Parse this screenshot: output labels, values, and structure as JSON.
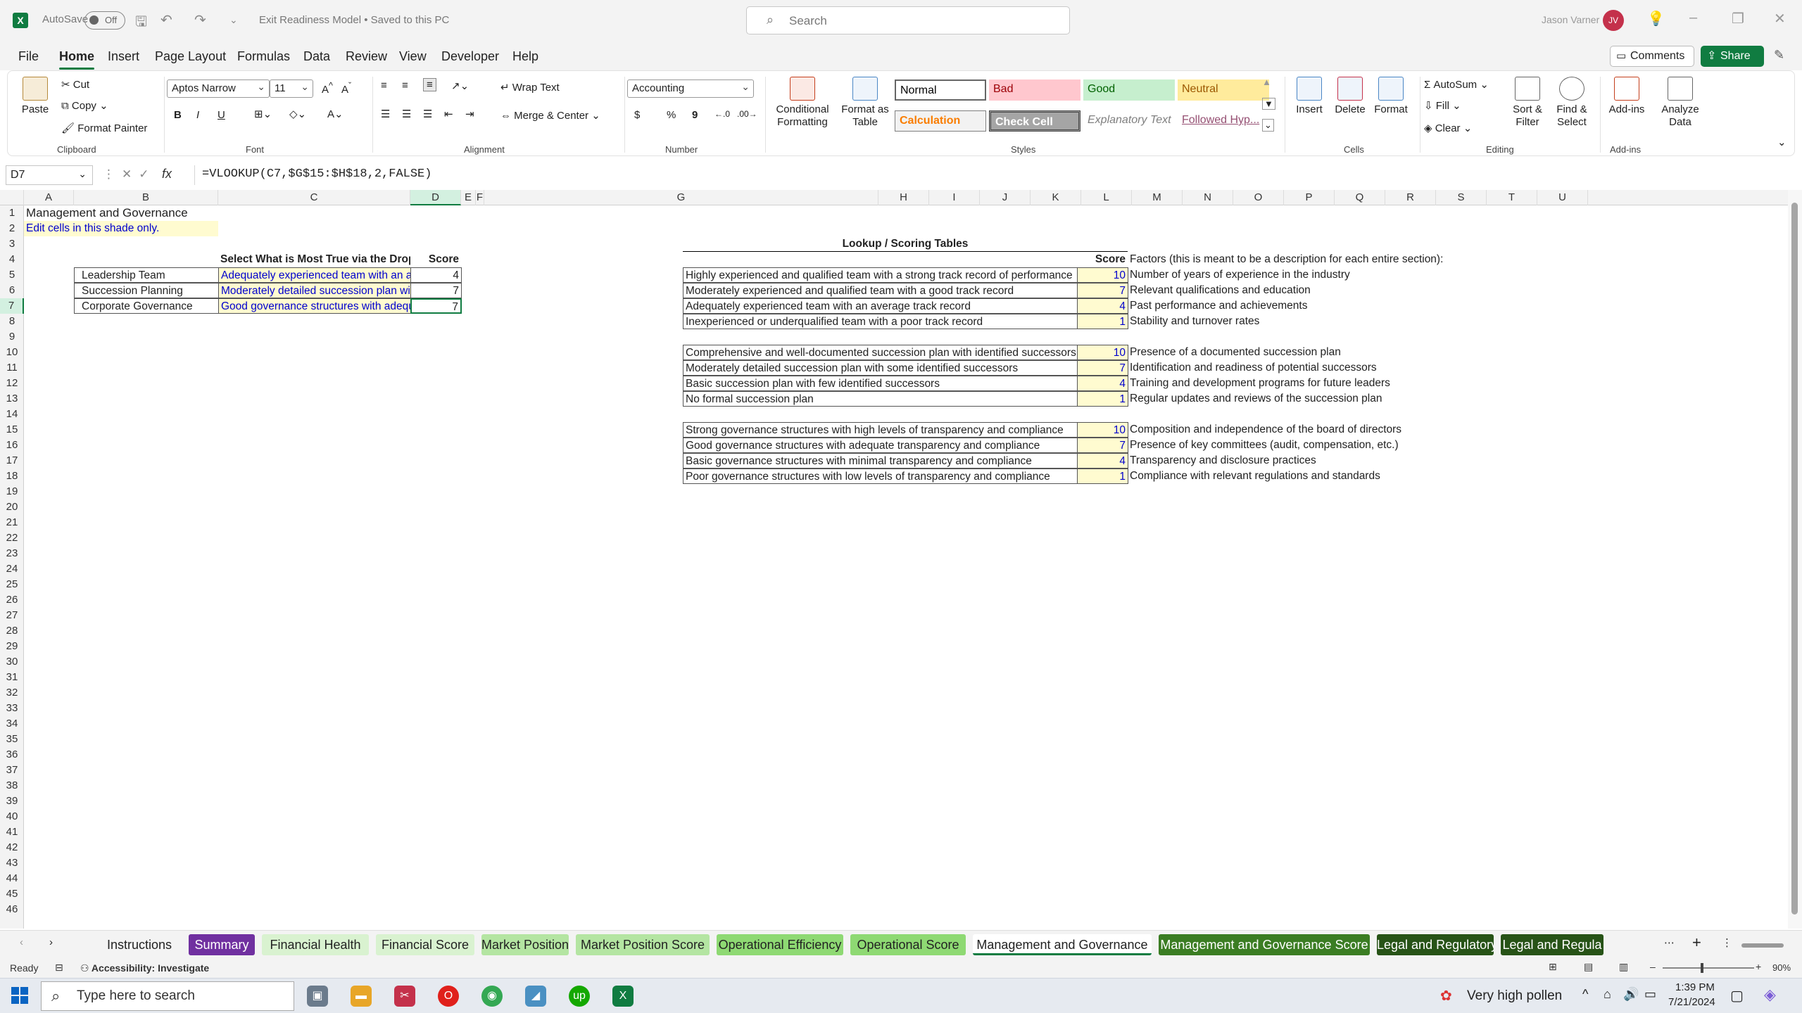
{
  "app": {
    "autosave_label": "AutoSave",
    "autosave_state": "Off",
    "doc_title": "Exit Readiness Model • Saved to this PC",
    "search_placeholder": "Search",
    "user_name": "Jason Varner",
    "user_initials": "JV"
  },
  "menu": {
    "tabs": [
      "File",
      "Home",
      "Insert",
      "Page Layout",
      "Formulas",
      "Data",
      "Review",
      "View",
      "Developer",
      "Help"
    ],
    "active": "Home",
    "comments": "Comments",
    "share": "Share"
  },
  "ribbon": {
    "clipboard": {
      "paste": "Paste",
      "cut": "Cut",
      "copy": "Copy",
      "format_painter": "Format Painter",
      "label": "Clipboard"
    },
    "font": {
      "name": "Aptos Narrow",
      "size": "11",
      "bold": "B",
      "italic": "I",
      "underline": "U",
      "label": "Font"
    },
    "alignment": {
      "wrap": "Wrap Text",
      "merge": "Merge & Center",
      "label": "Alignment"
    },
    "number": {
      "format": "Accounting",
      "currency": "$",
      "percent": "%",
      "comma": "9",
      "label": "Number"
    },
    "styles": {
      "conditional": "Conditional Formatting",
      "format_table": "Format as Table",
      "cells": [
        {
          "name": "Normal",
          "bg": "#ffffff",
          "fg": "#000000"
        },
        {
          "name": "Bad",
          "bg": "#ffc7ce",
          "fg": "#9c0006"
        },
        {
          "name": "Good",
          "bg": "#c6efce",
          "fg": "#006100"
        },
        {
          "name": "Neutral",
          "bg": "#ffeb9c",
          "fg": "#9c5700"
        },
        {
          "name": "Calculation",
          "bg": "#f2f2f2",
          "fg": "#fa7d00"
        },
        {
          "name": "Check Cell",
          "bg": "#a5a5a5",
          "fg": "#ffffff"
        },
        {
          "name": "Explanatory Text",
          "bg": "#ffffff",
          "fg": "#7f7f7f"
        },
        {
          "name": "Followed Hyp...",
          "bg": "#ffffff",
          "fg": "#954f72"
        }
      ],
      "label": "Styles"
    },
    "cells": {
      "insert": "Insert",
      "delete": "Delete",
      "format": "Format",
      "label": "Cells"
    },
    "editing": {
      "autosum": "AutoSum",
      "fill": "Fill",
      "clear": "Clear",
      "sort": "Sort & Filter",
      "find": "Find & Select",
      "label": "Editing"
    },
    "addins": {
      "addins": "Add-ins",
      "analyze": "Analyze Data",
      "label": "Add-ins"
    }
  },
  "formula_bar": {
    "name_box": "D7",
    "formula": "=VLOOKUP(C7,$G$15:$H$18,2,FALSE)",
    "fx": "fx"
  },
  "columns": [
    "A",
    "B",
    "C",
    "D",
    "E",
    "F",
    "G",
    "H",
    "I",
    "J",
    "K",
    "L",
    "M",
    "N",
    "O",
    "P",
    "Q",
    "R",
    "S",
    "T",
    "U"
  ],
  "sheet": {
    "title": "Management and Governance",
    "edit_note": "Edit cells in this shade only.",
    "select_header": "Select What is Most True via the Dropdown in Each Box",
    "score_header": "Score",
    "inputs": [
      {
        "label": "Leadership Team",
        "value": "Adequately experienced team with an average track record",
        "score": "4"
      },
      {
        "label": "Succession Planning",
        "value": "Moderately detailed succession plan with some identified successors",
        "score": "7"
      },
      {
        "label": "Corporate Governance",
        "value": "Good governance structures with adequate transparency and compliance",
        "score": "7"
      }
    ],
    "lookup_title": "Lookup  / Scoring Tables",
    "lookup_score_header": "Score",
    "factors_header": "Factors (this is meant to be a description for each entire section):",
    "lookup_tables": [
      [
        {
          "text": "Highly experienced and qualified team with a strong track record of performance",
          "score": "10",
          "factor": "Number of years of experience in the industry"
        },
        {
          "text": "Moderately experienced and qualified team with a good track record",
          "score": "7",
          "factor": "Relevant qualifications and education"
        },
        {
          "text": "Adequately experienced team with an average track record",
          "score": "4",
          "factor": "Past performance and achievements"
        },
        {
          "text": "Inexperienced or underqualified team with a poor track record",
          "score": "1",
          "factor": "Stability and turnover rates"
        }
      ],
      [
        {
          "text": "Comprehensive and well-documented succession plan with identified successors",
          "score": "10",
          "factor": "Presence of a documented succession plan"
        },
        {
          "text": "Moderately detailed succession plan with some identified successors",
          "score": "7",
          "factor": "Identification and readiness of potential successors"
        },
        {
          "text": "Basic succession plan with few identified successors",
          "score": "4",
          "factor": "Training and development programs for future leaders"
        },
        {
          "text": "No formal succession plan",
          "score": "1",
          "factor": "Regular updates and reviews of the succession plan"
        }
      ],
      [
        {
          "text": "Strong governance structures with high levels of transparency and compliance",
          "score": "10",
          "factor": "Composition and independence of the board of directors"
        },
        {
          "text": "Good governance structures with adequate transparency and compliance",
          "score": "7",
          "factor": "Presence of key committees (audit, compensation, etc.)"
        },
        {
          "text": "Basic governance structures with minimal transparency and compliance",
          "score": "4",
          "factor": "Transparency and disclosure practices"
        },
        {
          "text": "Poor governance structures with low levels of transparency and compliance",
          "score": "1",
          "factor": "Compliance with relevant regulations and standards"
        }
      ]
    ]
  },
  "sheet_tabs": [
    {
      "name": "Instructions",
      "bg": "#f3f3f3",
      "fg": "#222222"
    },
    {
      "name": "Summary",
      "bg": "#7030a0",
      "fg": "#ffffff"
    },
    {
      "name": "Financial Health",
      "bg": "#d9f2d0",
      "fg": "#222222"
    },
    {
      "name": "Financial Score",
      "bg": "#d9f2d0",
      "fg": "#222222"
    },
    {
      "name": "Market Position",
      "bg": "#b4e5a2",
      "fg": "#222222"
    },
    {
      "name": "Market Position Score",
      "bg": "#b4e5a2",
      "fg": "#222222"
    },
    {
      "name": "Operational Efficiency",
      "bg": "#8ed973",
      "fg": "#222222"
    },
    {
      "name": "Operational Score",
      "bg": "#8ed973",
      "fg": "#222222"
    },
    {
      "name": "Management and Governance",
      "bg": "#ffffff",
      "fg": "#222222",
      "active": true
    },
    {
      "name": "Management and Governance Score",
      "bg": "#3b7d23",
      "fg": "#ffffff"
    },
    {
      "name": "Legal and Regulatory",
      "bg": "#275317",
      "fg": "#ffffff"
    },
    {
      "name": "Legal and Regula",
      "bg": "#275317",
      "fg": "#ffffff"
    }
  ],
  "status": {
    "ready": "Ready",
    "accessibility": "Accessibility: Investigate",
    "zoom": "90%"
  },
  "taskbar": {
    "search_placeholder": "Type here to search",
    "weather": "Very high pollen",
    "time": "1:39 PM",
    "date": "7/21/2024"
  }
}
